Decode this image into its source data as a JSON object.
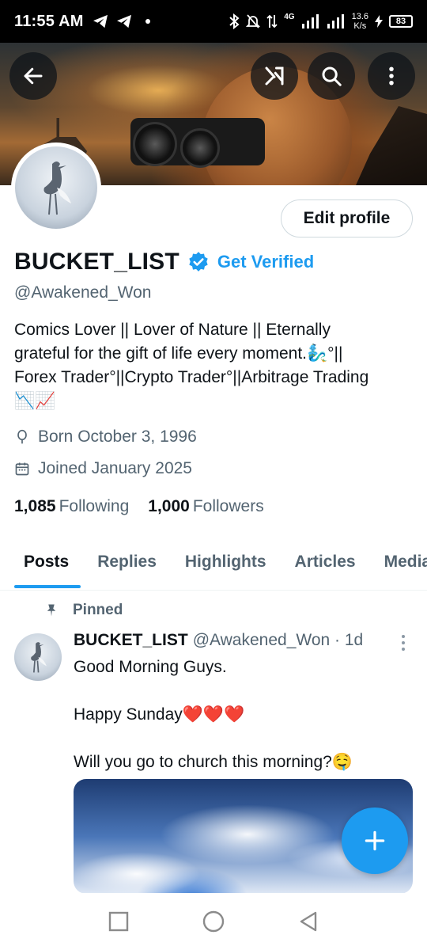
{
  "status_bar": {
    "time": "11:55 AM",
    "network_label": "4G",
    "speed_value": "13.6",
    "speed_unit": "K/s",
    "battery": "83"
  },
  "header": {
    "back_icon": "arrow-left-icon",
    "grok_icon": "grok-icon",
    "search_icon": "search-icon",
    "more_icon": "more-vertical-icon"
  },
  "profile": {
    "edit_profile_label": "Edit profile",
    "display_name": "BUCKET_LIST",
    "get_verified_label": "Get Verified",
    "handle": "@Awakened_Won",
    "bio_lines": [
      "Comics Lover || Lover of Nature || Eternally",
      "grateful for the gift of life every moment.🧞‍♂️°||",
      "Forex Trader°||Crypto Trader°||Arbitrage Trading",
      "📉📈"
    ],
    "born": "Born October 3, 1996",
    "joined": "Joined January 2025",
    "following_count": "1,085",
    "following_label": "Following",
    "followers_count": "1,000",
    "followers_label": "Followers",
    "accent_color": "#1d9bf0"
  },
  "tabs": [
    {
      "label": "Posts",
      "active": true
    },
    {
      "label": "Replies",
      "active": false
    },
    {
      "label": "Highlights",
      "active": false
    },
    {
      "label": "Articles",
      "active": false
    },
    {
      "label": "Media",
      "active": false
    }
  ],
  "pinned_post": {
    "pinned_label": "Pinned",
    "author_name": "BUCKET_LIST",
    "author_meta": "@Awakened_Won · 1d",
    "paragraphs": [
      "Good Morning Guys.",
      "Happy Sunday❤️❤️❤️",
      "Will you go to church this morning?🤤"
    ]
  },
  "fab": {
    "icon": "plus-icon"
  },
  "system_nav": {
    "recent_icon": "square-icon",
    "home_icon": "circle-icon",
    "back_icon": "triangle-back-icon"
  }
}
